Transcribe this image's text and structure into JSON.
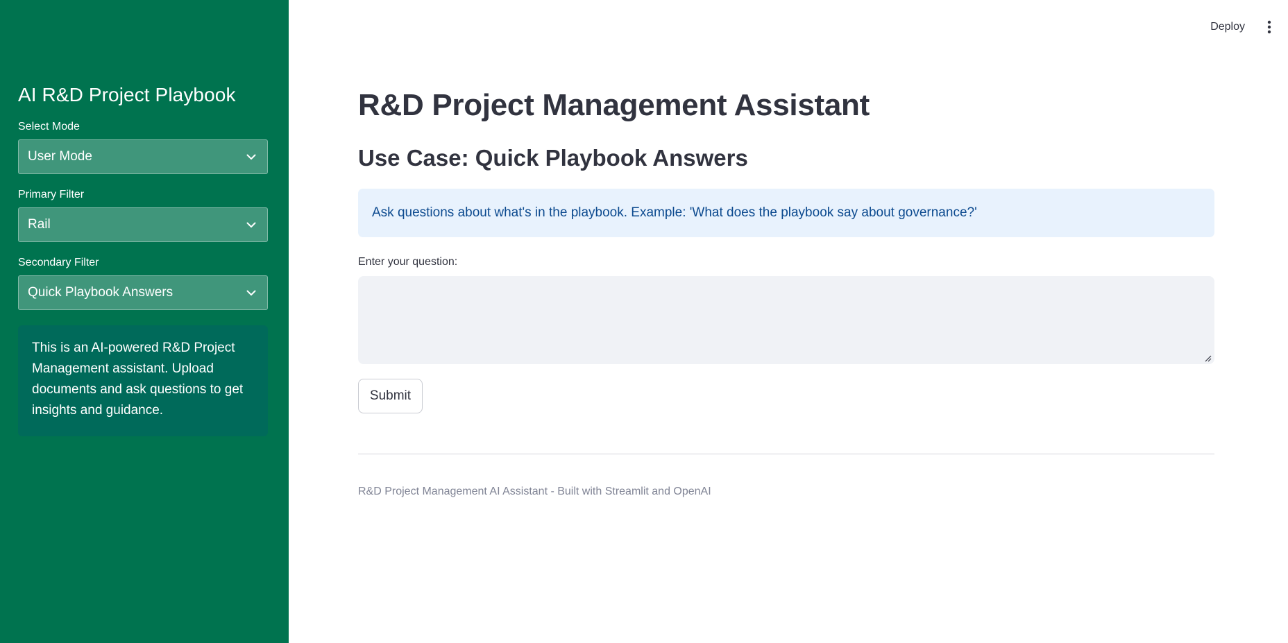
{
  "sidebar": {
    "title": "AI R&D Project Playbook",
    "mode": {
      "label": "Select Mode",
      "value": "User Mode"
    },
    "primary_filter": {
      "label": "Primary Filter",
      "value": "Rail"
    },
    "secondary_filter": {
      "label": "Secondary Filter",
      "value": "Quick Playbook Answers"
    },
    "info": "This is an AI-powered R&D Project Management assistant. Upload documents and ask questions to get insights and guidance."
  },
  "toolbar": {
    "deploy_label": "Deploy",
    "menu_icon": "vertical-dots-icon"
  },
  "main": {
    "title": "R&D Project Management Assistant",
    "use_case_title": "Use Case: Quick Playbook Answers",
    "info_alert": "Ask questions about what's in the playbook. Example: 'What does the playbook say about governance?'",
    "question_label": "Enter your question:",
    "question_value": "",
    "submit_label": "Submit",
    "footer": "R&D Project Management AI Assistant - Built with Streamlit and OpenAI"
  },
  "colors": {
    "sidebar_bg": "#00734f",
    "info_box_bg": "#006a5a",
    "alert_bg": "#e8f2fd",
    "alert_text": "#0c4a8f",
    "text_primary": "#31333f"
  }
}
